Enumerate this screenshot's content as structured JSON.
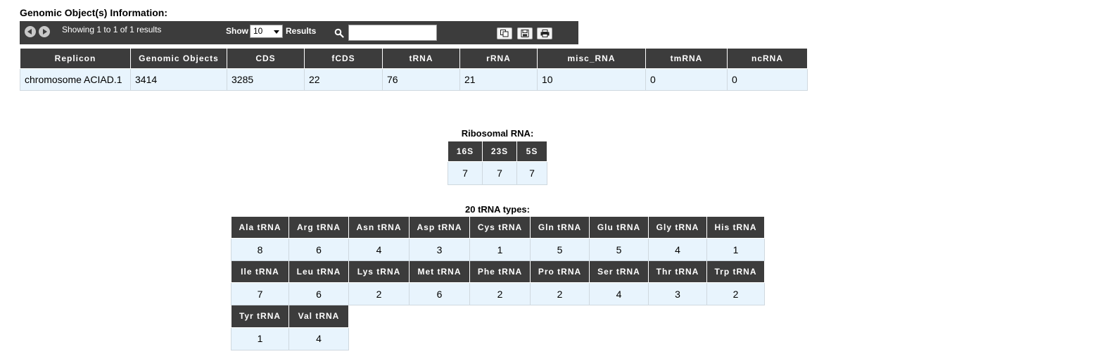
{
  "section_title": "Genomic Object(s) Information:",
  "toolbar": {
    "info": "Showing 1 to 1 of 1 results",
    "show_label": "Show",
    "length_value": "10",
    "results_label": "Results",
    "search_value": "",
    "icons": [
      "prev-page-icon",
      "next-page-icon",
      "search-icon",
      "copy-icon",
      "save-icon",
      "print-icon"
    ]
  },
  "main_table": {
    "headers": [
      "Replicon",
      "Genomic Objects",
      "CDS",
      "fCDS",
      "tRNA",
      "rRNA",
      "misc_RNA",
      "tmRNA",
      "ncRNA"
    ],
    "rows": [
      [
        "chromosome ACIAD.1",
        "3414",
        "3285",
        "22",
        "76",
        "21",
        "10",
        "0",
        "0"
      ]
    ]
  },
  "rrna": {
    "caption": "Ribosomal RNA:",
    "headers": [
      "16S",
      "23S",
      "5S"
    ],
    "values": [
      "7",
      "7",
      "7"
    ]
  },
  "trna": {
    "caption": "20 tRNA types:",
    "rows": [
      {
        "headers": [
          "Ala tRNA",
          "Arg tRNA",
          "Asn tRNA",
          "Asp tRNA",
          "Cys tRNA",
          "Gln tRNA",
          "Glu tRNA",
          "Gly tRNA",
          "His tRNA"
        ],
        "values": [
          "8",
          "6",
          "4",
          "3",
          "1",
          "5",
          "5",
          "4",
          "1"
        ]
      },
      {
        "headers": [
          "Ile tRNA",
          "Leu tRNA",
          "Lys tRNA",
          "Met tRNA",
          "Phe tRNA",
          "Pro tRNA",
          "Ser tRNA",
          "Thr tRNA",
          "Trp tRNA"
        ],
        "values": [
          "7",
          "6",
          "2",
          "6",
          "2",
          "2",
          "4",
          "3",
          "2"
        ]
      },
      {
        "headers": [
          "Tyr tRNA",
          "Val tRNA"
        ],
        "values": [
          "1",
          "4"
        ]
      }
    ]
  }
}
